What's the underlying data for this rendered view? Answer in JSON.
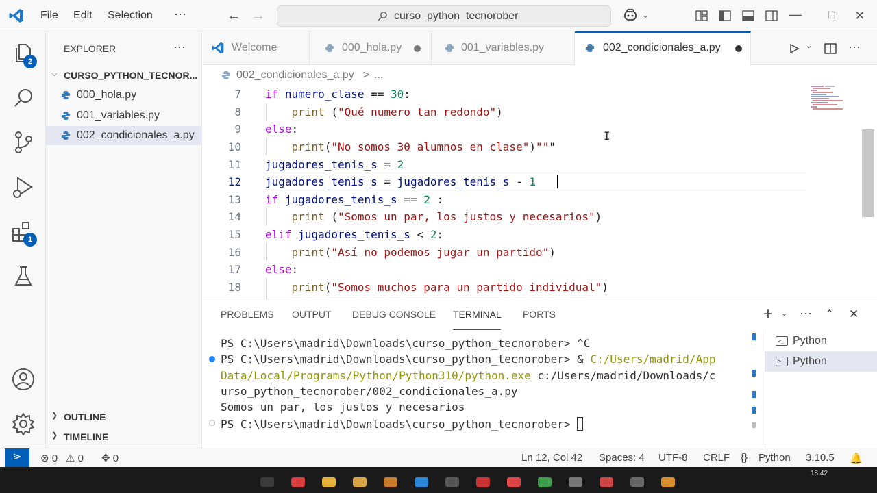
{
  "menu": {
    "file": "File",
    "edit": "Edit",
    "selection": "Selection",
    "more": "···"
  },
  "search": {
    "text": "curso_python_tecnorober"
  },
  "activity": {
    "explorer_badge": "2",
    "extensions_badge": "1"
  },
  "sidebar": {
    "title": "EXPLORER",
    "more": "···",
    "folder": "CURSO_PYTHON_TECNOR...",
    "files": [
      "000_hola.py",
      "001_variables.py",
      "002_condicionales_a.py"
    ],
    "outline": "OUTLINE",
    "timeline": "TIMELINE"
  },
  "tabs": [
    "Welcome",
    "000_hola.py",
    "001_variables.py",
    "002_condicionales_a.py"
  ],
  "breadcrumb": {
    "file": "002_condicionales_a.py",
    "sep": ">",
    "rest": "..."
  },
  "editor": {
    "line_numbers": [
      "7",
      "8",
      "9",
      "10",
      "11",
      "12",
      "13",
      "14",
      "15",
      "16",
      "17",
      "18"
    ],
    "lines": [
      "if numero_clase == 30:",
      "    print (\"Qué numero tan redondo\")",
      "else:",
      "    print(\"No somos 30 alumnos en clase\")\"\"\"",
      "jugadores_tenis_s = 2",
      "jugadores_tenis_s = jugadores_tenis_s - 1",
      "if jugadores_tenis_s == 2 :",
      "    print (\"Somos un par, los justos y necesarios\")",
      "elif jugadores_tenis_s < 2:",
      "    print(\"Así no podemos jugar un partido\")",
      "else:",
      "    print(\"Somos muchos para un partido individual\")"
    ]
  },
  "panel": {
    "tabs": [
      "PROBLEMS",
      "OUTPUT",
      "DEBUG CONSOLE",
      "TERMINAL",
      "PORTS"
    ],
    "active_tab": "TERMINAL",
    "terminal_lines": [
      "PS C:\\Users\\madrid\\Downloads\\curso_python_tecnorober> ^C",
      "PS C:\\Users\\madrid\\Downloads\\curso_python_tecnorober> & ",
      "C:/Users/madrid/App",
      "Data/Local/Programs/Python/Python310/python.exe",
      " c:/Users/madrid/Downloads/c",
      "urso_python_tecnorober/002_condicionales_a.py",
      "Somos un par, los justos y necesarios",
      "PS C:\\Users\\madrid\\Downloads\\curso_python_tecnorober> "
    ],
    "terminals": [
      "Python",
      "Python"
    ]
  },
  "status": {
    "errors": "0",
    "warnings": "0",
    "ports": "0",
    "position": "Ln 12, Col 42",
    "spaces": "Spaces: 4",
    "encoding": "UTF-8",
    "eol": "CRLF",
    "braces": "{}",
    "language": "Python",
    "version": "3.10.5"
  },
  "taskbar": {
    "time": "18:42"
  },
  "colors": {
    "accent": "#005fb8",
    "keyword": "#af00db",
    "string": "#a31515",
    "number": "#098658",
    "variable": "#001080"
  }
}
